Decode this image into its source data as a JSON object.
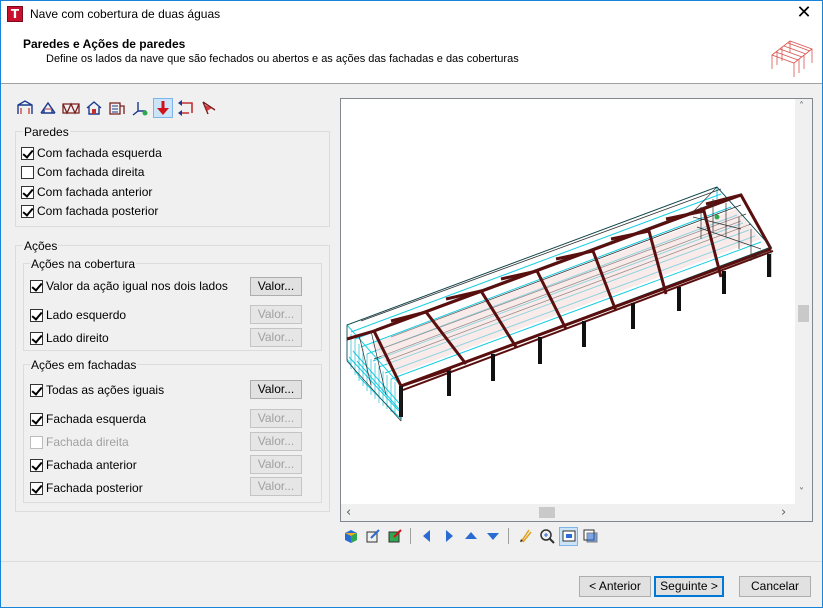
{
  "window": {
    "title": "Nave com cobertura de duas águas",
    "app_icon_letter": "T",
    "close_glyph": "✕"
  },
  "header": {
    "title": "Paredes e Ações de paredes",
    "subtitle": "Define os lados da nave que são fechados ou abertos e as ações das fachadas e das coberturas"
  },
  "toolbar": {
    "icons": [
      "frame-icon",
      "gable-icon",
      "truss-icon",
      "house-icon",
      "building-icon",
      "axis-icon",
      "load-arrow-icon",
      "reverse-load-icon",
      "wind-icon"
    ],
    "active_index": 6
  },
  "walls": {
    "legend": "Paredes",
    "items": [
      {
        "label": "Com fachada esquerda",
        "checked": true
      },
      {
        "label": "Com fachada direita",
        "checked": false
      },
      {
        "label": "Com fachada anterior",
        "checked": true
      },
      {
        "label": "Com fachada posterior",
        "checked": true
      }
    ]
  },
  "actions": {
    "legend": "Ações",
    "roof": {
      "legend": "Ações na cobertura",
      "same_both": {
        "label": "Valor da ação igual nos dois lados",
        "checked": true,
        "button": "Valor..."
      },
      "left": {
        "label": "Lado esquerdo",
        "checked": true,
        "button": "Valor..."
      },
      "right": {
        "label": "Lado direito",
        "checked": true,
        "button": "Valor..."
      }
    },
    "facades": {
      "legend": "Ações em fachadas",
      "all_same": {
        "label": "Todas as ações iguais",
        "checked": true,
        "button": "Valor..."
      },
      "left": {
        "label": "Fachada esquerda",
        "checked": true,
        "button": "Valor..."
      },
      "right": {
        "label": "Fachada direita",
        "checked": false,
        "button": "Valor..."
      },
      "front": {
        "label": "Fachada anterior",
        "checked": true,
        "button": "Valor..."
      },
      "back": {
        "label": "Fachada posterior",
        "checked": true,
        "button": "Valor..."
      }
    }
  },
  "viewer": {
    "scroll": {
      "up": "˄",
      "down": "˅",
      "left": "‹",
      "right": "›"
    },
    "tools": [
      "cube-icon",
      "edit-view-icon",
      "paint-view-icon",
      "arrow-left-icon",
      "arrow-right-icon",
      "arrow-up-icon",
      "arrow-down-icon",
      "pan-icon",
      "zoom-icon",
      "zoom-window-icon",
      "zoom-extents-icon"
    ],
    "colors": {
      "steel": "#5a0f0f",
      "cladding": "#00c8e0",
      "wire": "#303030",
      "column": "#101010"
    }
  },
  "buttons": {
    "previous": "< Anterior",
    "next": "Seguinte >",
    "cancel": "Cancelar"
  }
}
